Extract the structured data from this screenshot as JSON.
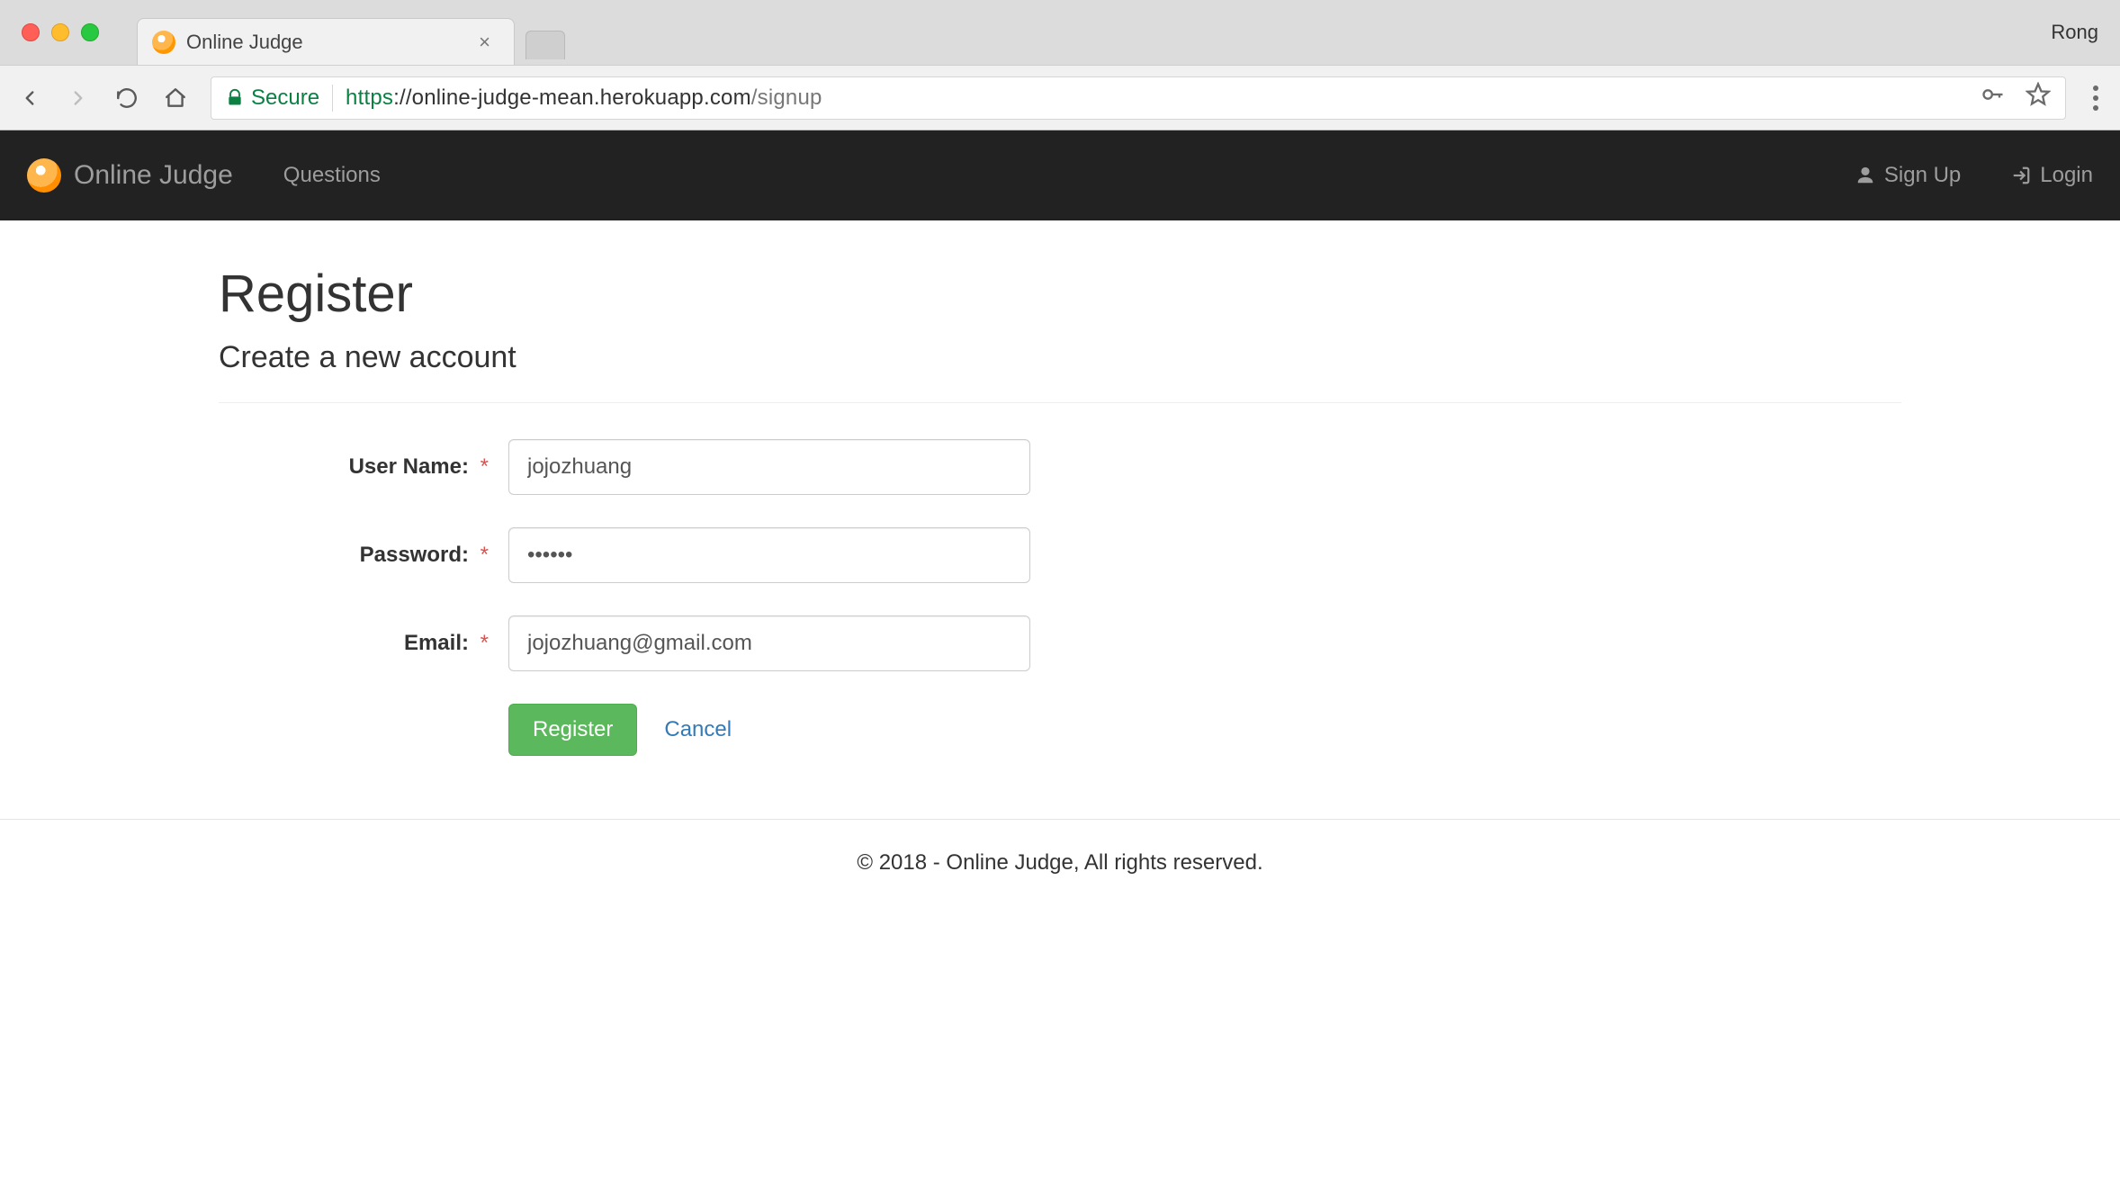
{
  "browser": {
    "profile_name": "Rong",
    "tab_title": "Online Judge",
    "secure_label": "Secure",
    "url_scheme": "https",
    "url_host": "://online-judge-mean.herokuapp.com",
    "url_path": "/signup"
  },
  "navbar": {
    "brand": "Online Judge",
    "links": [
      "Questions"
    ],
    "signup_label": "Sign Up",
    "login_label": "Login"
  },
  "page": {
    "heading": "Register",
    "subtitle": "Create a new account"
  },
  "form": {
    "username": {
      "label": "User Name:",
      "value": "jojozhuang"
    },
    "password": {
      "label": "Password:",
      "value": "••••••"
    },
    "email": {
      "label": "Email:",
      "value": "jojozhuang@gmail.com"
    },
    "required_mark": "*",
    "register_button": "Register",
    "cancel_link": "Cancel"
  },
  "footer": {
    "text": "© 2018 - Online Judge, All rights reserved."
  }
}
